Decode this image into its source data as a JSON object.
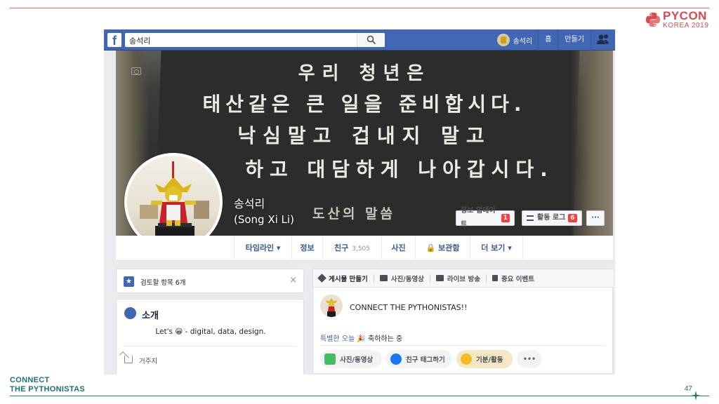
{
  "slide": {
    "brand": "PYCON",
    "brand_sub": "KOREA 2019",
    "footer_line1": "CONNECT",
    "footer_line2": "THE PYTHONISTAS",
    "page_number": "47"
  },
  "colors": {
    "facebook_blue": "#4267b2",
    "pycon_red": "#e0474c",
    "footer_teal": "#1f6f74"
  },
  "fb": {
    "logo": "f",
    "search_value": "송석리",
    "nav_user": "송석리",
    "nav_home": "홈",
    "nav_create": "만들기"
  },
  "cover": {
    "line1": "우리 청년은",
    "line2": "태산같은 큰 일을 준비합시다.",
    "line3": "낙심말고 겁내지 말고",
    "line4": "하고 대담하게 나아갑시다.",
    "signature": "도산의 말씀"
  },
  "profile": {
    "name": "송석리",
    "alt_name": "(Song Xi Li)",
    "update_info": "정보 업데이트",
    "update_badge": "1",
    "activity_log": "활동 로그",
    "activity_badge": "6",
    "more": "···"
  },
  "tabs": [
    {
      "label": "타임라인 ▾"
    },
    {
      "label": "정보"
    },
    {
      "label": "친구",
      "count": "3,505"
    },
    {
      "label": "사진"
    },
    {
      "label": "🔒 보관함"
    },
    {
      "label": "더 보기 ▾"
    }
  ],
  "review": {
    "star": "★",
    "label": "검토할 항목 6개",
    "close": "×"
  },
  "intro": {
    "title": "소개",
    "bio": "Let's 😀 - digital, data, design.",
    "residence": "거주지"
  },
  "composer": {
    "tabs": [
      "게시물 만들기",
      "사진/동영상",
      "라이브 방송",
      "중요 이벤트"
    ],
    "post_text": "CONNECT THE PYTHONISTAS!!",
    "special_prefix": "특별한 오늘",
    "special_suffix": "🎉 축하하는 중",
    "actions": [
      "사진/동영상",
      "친구 태그하기",
      "기분/활동",
      "•••"
    ]
  }
}
